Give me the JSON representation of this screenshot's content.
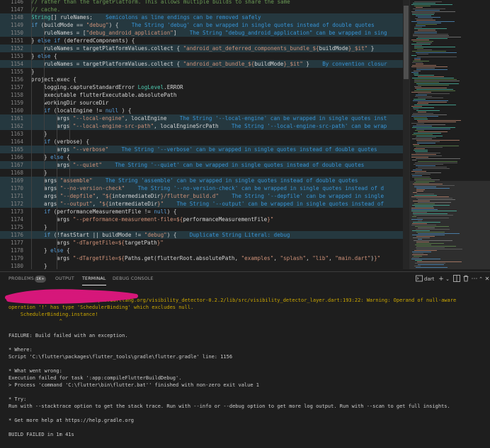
{
  "editor": {
    "lines": [
      {
        "n": "1146",
        "hl": false,
        "indent": 2,
        "segs": [
          [
            "cm",
            "// rather than the targetPlatform. This allows multiple builds to share the same"
          ]
        ]
      },
      {
        "n": "1147",
        "hl": false,
        "indent": 2,
        "segs": [
          [
            "cm",
            "// cache."
          ]
        ]
      },
      {
        "n": "1148",
        "hl": true,
        "indent": 2,
        "segs": [
          [
            "ty",
            "String"
          ],
          [
            "",
            "[] ruleNames;    "
          ],
          [
            "hint",
            "Semicolons as line endings can be removed safely"
          ]
        ]
      },
      {
        "n": "1149",
        "hl": true,
        "indent": 2,
        "segs": [
          [
            "kw",
            "if"
          ],
          [
            "",
            " (buildMode == "
          ],
          [
            "str",
            "\"debug\""
          ],
          [
            "",
            ") {    "
          ],
          [
            "hint",
            "The String 'debug' can be wrapped in single quotes instead of double quotes"
          ]
        ]
      },
      {
        "n": "1150",
        "hl": true,
        "indent": 3,
        "segs": [
          [
            "",
            "ruleNames = ["
          ],
          [
            "str",
            "\"debug_android_application\""
          ],
          [
            "",
            "]    "
          ],
          [
            "hint",
            "The String \"debug_android_application\" can be wrapped in sing"
          ]
        ]
      },
      {
        "n": "1151",
        "hl": false,
        "indent": 2,
        "segs": [
          [
            "",
            "} "
          ],
          [
            "kw",
            "else if"
          ],
          [
            "",
            " (deferredComponents) {"
          ]
        ]
      },
      {
        "n": "1152",
        "hl": true,
        "indent": 3,
        "segs": [
          [
            "",
            "ruleNames = targetPlatformValues.collect { "
          ],
          [
            "str",
            "\"android_aot_deferred_components_bundle_${"
          ],
          [
            "",
            "buildMode"
          ],
          [
            "str",
            "}_$it\""
          ],
          [
            "",
            " }"
          ]
        ]
      },
      {
        "n": "1153",
        "hl": false,
        "indent": 2,
        "segs": [
          [
            "",
            "} "
          ],
          [
            "kw",
            "else"
          ],
          [
            "",
            " {"
          ]
        ]
      },
      {
        "n": "1154",
        "hl": true,
        "indent": 3,
        "segs": [
          [
            "",
            "ruleNames = targetPlatformValues.collect { "
          ],
          [
            "str",
            "\"android_aot_bundle_${"
          ],
          [
            "",
            "buildMode"
          ],
          [
            "str",
            "}_$it\""
          ],
          [
            "",
            " }    "
          ],
          [
            "hint",
            "By convention closur"
          ]
        ]
      },
      {
        "n": "1155",
        "hl": false,
        "indent": 2,
        "segs": [
          [
            "",
            "}"
          ]
        ]
      },
      {
        "n": "1156",
        "hl": false,
        "indent": 2,
        "segs": [
          [
            "",
            "project.exec {"
          ]
        ]
      },
      {
        "n": "1157",
        "hl": false,
        "indent": 3,
        "segs": [
          [
            "",
            "logging.captureStandardError "
          ],
          [
            "ty",
            "LogLevel"
          ],
          [
            "",
            ".ERROR"
          ]
        ]
      },
      {
        "n": "1158",
        "hl": false,
        "indent": 3,
        "segs": [
          [
            "",
            "executable flutterExecutable.absolutePath"
          ]
        ]
      },
      {
        "n": "1159",
        "hl": false,
        "indent": 3,
        "segs": [
          [
            "",
            "workingDir sourceDir"
          ]
        ]
      },
      {
        "n": "1160",
        "hl": false,
        "indent": 3,
        "segs": [
          [
            "kw",
            "if"
          ],
          [
            "",
            " (localEngine != "
          ],
          [
            "kw",
            "null"
          ],
          [
            "",
            " ) {"
          ]
        ]
      },
      {
        "n": "1161",
        "hl": true,
        "indent": 4,
        "segs": [
          [
            "",
            "args "
          ],
          [
            "str",
            "\"--local-engine\""
          ],
          [
            "",
            ", localEngine    "
          ],
          [
            "hint",
            "The String '--local-engine' can be wrapped in single quotes inst"
          ]
        ]
      },
      {
        "n": "1162",
        "hl": true,
        "indent": 4,
        "segs": [
          [
            "",
            "args "
          ],
          [
            "str",
            "\"--local-engine-src-path\""
          ],
          [
            "",
            ", localEngineSrcPath    "
          ],
          [
            "hint",
            "The String '--local-engine-src-path' can be wrap"
          ]
        ]
      },
      {
        "n": "1163",
        "hl": false,
        "indent": 3,
        "segs": [
          [
            "",
            "}"
          ]
        ]
      },
      {
        "n": "1164",
        "hl": false,
        "indent": 3,
        "segs": [
          [
            "kw",
            "if"
          ],
          [
            "",
            " (verbose) {"
          ]
        ]
      },
      {
        "n": "1165",
        "hl": true,
        "indent": 4,
        "segs": [
          [
            "",
            "args "
          ],
          [
            "str",
            "\"--verbose\""
          ],
          [
            "",
            "    "
          ],
          [
            "hint",
            "The String '--verbose' can be wrapped in single quotes instead of double quotes"
          ]
        ]
      },
      {
        "n": "1166",
        "hl": false,
        "indent": 3,
        "segs": [
          [
            "",
            "} "
          ],
          [
            "kw",
            "else"
          ],
          [
            "",
            " {"
          ]
        ]
      },
      {
        "n": "1167",
        "hl": true,
        "indent": 4,
        "segs": [
          [
            "",
            "args "
          ],
          [
            "str",
            "\"--quiet\""
          ],
          [
            "",
            "    "
          ],
          [
            "hint",
            "The String '--quiet' can be wrapped in single quotes instead of double quotes"
          ]
        ]
      },
      {
        "n": "1168",
        "hl": false,
        "indent": 3,
        "segs": [
          [
            "",
            "}"
          ]
        ]
      },
      {
        "n": "1169",
        "hl": true,
        "indent": 3,
        "segs": [
          [
            "",
            "args "
          ],
          [
            "str",
            "\"assemble\""
          ],
          [
            "",
            "    "
          ],
          [
            "hint",
            "The String 'assemble' can be wrapped in single quotes instead of double quotes"
          ]
        ]
      },
      {
        "n": "1170",
        "hl": true,
        "indent": 3,
        "segs": [
          [
            "",
            "args "
          ],
          [
            "str",
            "\"--no-version-check\""
          ],
          [
            "",
            "    "
          ],
          [
            "hint",
            "The String '--no-version-check' can be wrapped in single quotes instead of d"
          ]
        ]
      },
      {
        "n": "1171",
        "hl": true,
        "indent": 3,
        "segs": [
          [
            "",
            "args "
          ],
          [
            "str",
            "\"--depfile\""
          ],
          [
            "",
            ", "
          ],
          [
            "str",
            "\"${"
          ],
          [
            "",
            "intermediateDir"
          ],
          [
            "str",
            "}/flutter_build.d\""
          ],
          [
            "",
            "    "
          ],
          [
            "hint",
            "The String '--depfile' can be wrapped in single"
          ]
        ]
      },
      {
        "n": "1172",
        "hl": true,
        "indent": 3,
        "segs": [
          [
            "",
            "args "
          ],
          [
            "str",
            "\"--output\""
          ],
          [
            "",
            ", "
          ],
          [
            "str",
            "\"${"
          ],
          [
            "",
            "intermediateDir"
          ],
          [
            "str",
            "}\""
          ],
          [
            "",
            "    "
          ],
          [
            "hint",
            "The String '--output' can be wrapped in single quotes instead of"
          ]
        ]
      },
      {
        "n": "1173",
        "hl": false,
        "indent": 3,
        "segs": [
          [
            "kw",
            "if"
          ],
          [
            "",
            " (performanceMeasurementFile != "
          ],
          [
            "kw",
            "null"
          ],
          [
            "",
            ") {"
          ]
        ]
      },
      {
        "n": "1174",
        "hl": false,
        "indent": 4,
        "segs": [
          [
            "",
            "args "
          ],
          [
            "str",
            "\"--performance-measurement-file=${"
          ],
          [
            "",
            "performanceMeasurementFile"
          ],
          [
            "str",
            "}\""
          ]
        ]
      },
      {
        "n": "1175",
        "hl": false,
        "indent": 3,
        "segs": [
          [
            "",
            "}"
          ]
        ]
      },
      {
        "n": "1176",
        "hl": true,
        "indent": 3,
        "segs": [
          [
            "kw",
            "if"
          ],
          [
            "",
            " (!fastStart || buildMode != "
          ],
          [
            "str",
            "\"debug\""
          ],
          [
            "",
            ") {    "
          ],
          [
            "hint",
            "Duplicate String Literal: debug"
          ]
        ]
      },
      {
        "n": "1177",
        "hl": false,
        "indent": 4,
        "segs": [
          [
            "",
            "args "
          ],
          [
            "str",
            "\"-dTargetFile=${"
          ],
          [
            "",
            "targetPath"
          ],
          [
            "str",
            "}\""
          ]
        ]
      },
      {
        "n": "1178",
        "hl": false,
        "indent": 3,
        "segs": [
          [
            "",
            "} "
          ],
          [
            "kw",
            "else"
          ],
          [
            "",
            " {"
          ]
        ]
      },
      {
        "n": "1179",
        "hl": false,
        "indent": 4,
        "segs": [
          [
            "",
            "args "
          ],
          [
            "str",
            "\"-dTargetFile=${"
          ],
          [
            "",
            "Paths.get(flutterRoot.absolutePath, "
          ],
          [
            "str",
            "\"examples\""
          ],
          [
            "",
            ", "
          ],
          [
            "str",
            "\"splash\""
          ],
          [
            "",
            ", "
          ],
          [
            "str",
            "\"lib\""
          ],
          [
            "",
            ", "
          ],
          [
            "str",
            "\"main.dart\""
          ],
          [
            "",
            ")"
          ],
          [
            "str",
            "}\""
          ]
        ]
      },
      {
        "n": "1180",
        "hl": false,
        "indent": 3,
        "segs": [
          [
            "",
            "}"
          ]
        ]
      }
    ]
  },
  "panel": {
    "tabs": {
      "problems": "PROBLEMS",
      "problems_count": "1K+",
      "output": "OUTPUT",
      "terminal": "TERMINAL",
      "debug_console": "DEBUG CONSOLE"
    },
    "terminal_selector": "dart",
    "icons": {
      "terminal": "terminal-icon",
      "add": "plus-icon",
      "dropdown": "chevron-down-icon",
      "split": "split-terminal-icon",
      "trash": "trash-icon",
      "more": "ellipsis-icon",
      "maximize": "chevron-up-icon",
      "close": "close-icon"
    },
    "colors": {
      "accent_blue": "#3794d6",
      "string": "#ce9178",
      "keyword": "#569cd6",
      "comment": "#6a9955",
      "type": "#4ec9b0",
      "redaction": "#d6177a"
    }
  },
  "terminal": {
    "lines": [
      "                 ^",
      "                              pub.dartlang.org/visibility_detector-0.2.2/lib/src/visibility_detector_layer.dart:193:22: Warning: Operand of null-aware",
      "operation '!' has type 'SchedulerBinding' which excludes null.",
      "    SchedulerBinding.instance!",
      "                 ^",
      "",
      "FAILURE: Build failed with an exception.",
      "",
      "* Where:",
      "Script 'C:\\flutter\\packages\\flutter_tools\\gradle\\flutter.gradle' line: 1156",
      "",
      "* What went wrong:",
      "Execution failed for task ':app:compileFlutterBuildDebug'.",
      "> Process 'command 'C:\\flutter\\bin\\flutter.bat'' finished with non-zero exit value 1",
      "",
      "* Try:",
      "Run with --stacktrace option to get the stack trace. Run with --info or --debug option to get more log output. Run with --scan to get full insights.",
      "",
      "* Get more help at https://help.gradle.org",
      "",
      "BUILD FAILED in 1m 41s"
    ]
  }
}
